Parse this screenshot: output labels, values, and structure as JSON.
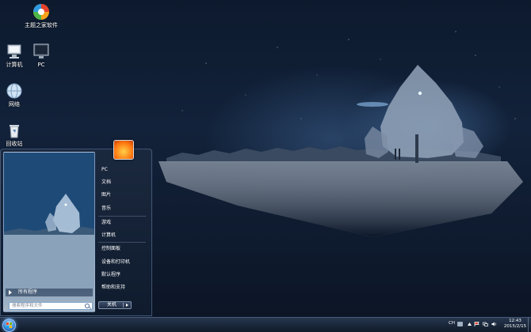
{
  "desktop": {
    "icons": [
      {
        "label": "主题之家软件",
        "icon": "theme-software-icon"
      },
      {
        "label": "计算机",
        "icon": "computer-icon"
      },
      {
        "label": "PC",
        "icon": "pc-monitor-icon"
      },
      {
        "label": "网络",
        "icon": "network-globe-icon"
      },
      {
        "label": "回收站",
        "icon": "recycle-bin-icon"
      }
    ]
  },
  "start_menu": {
    "all_programs_label": "所有程序",
    "search_placeholder": "搜索程序和文件",
    "right_items": [
      {
        "label": "PC"
      },
      {
        "label": "文档"
      },
      {
        "label": "图片"
      },
      {
        "label": "音乐"
      },
      {
        "label": "游戏"
      },
      {
        "label": "计算机"
      },
      {
        "label": "控制面板"
      },
      {
        "label": "设备和打印机"
      },
      {
        "label": "默认程序"
      },
      {
        "label": "帮助和支持"
      }
    ],
    "shutdown_label": "关机"
  },
  "taskbar": {
    "language": "CH",
    "time": "12:43",
    "date": "2015/2/15"
  },
  "colors": {
    "accent": "#3c8ad6",
    "taskbar": "#1a2a42",
    "menu": "#1c2a40"
  }
}
